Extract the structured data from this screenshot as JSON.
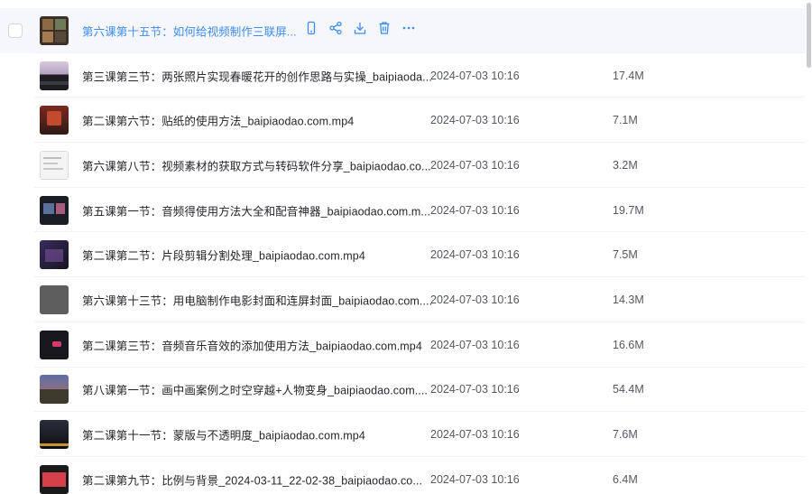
{
  "colors": {
    "accent": "#3f8cf0",
    "hover_bg": "#f5f7fd"
  },
  "hover_actions": [
    "phone-icon",
    "share-icon",
    "download-icon",
    "delete-icon",
    "more-icon"
  ],
  "files": [
    {
      "name": "第六课第十五节：如何给视频制作三联屏...",
      "date": "",
      "size": "",
      "thumb_icon": "video-thumbnail-icon",
      "hover": true,
      "thumb": "grid"
    },
    {
      "name": "第三课第三节：两张照片实现春暖花开的创作思路与实操_baipiaoda...",
      "date": "2024-07-03 10:16",
      "size": "17.4M",
      "thumb_icon": "video-thumbnail-icon",
      "thumb": "flower"
    },
    {
      "name": "第二课第六节：贴纸的使用方法_baipiaodao.com.mp4",
      "date": "2024-07-03 10:16",
      "size": "7.1M",
      "thumb_icon": "video-thumbnail-icon",
      "thumb": "red"
    },
    {
      "name": "第六课第八节：视频素材的获取方式与转码软件分享_baipiaodao.co...",
      "date": "2024-07-03 10:16",
      "size": "3.2M",
      "thumb_icon": "video-thumbnail-icon",
      "thumb": "doc"
    },
    {
      "name": "第五课第一节：音频得使用方法大全和配音神器_baipiaodao.com.m...",
      "date": "2024-07-03 10:16",
      "size": "19.7M",
      "thumb_icon": "video-thumbnail-icon",
      "thumb": "dark"
    },
    {
      "name": "第二课第二节：片段剪辑分割处理_baipiaodao.com.mp4",
      "date": "2024-07-03 10:16",
      "size": "7.5M",
      "thumb_icon": "video-thumbnail-icon",
      "thumb": "purple"
    },
    {
      "name": "第六课第十三节：用电脑制作电影封面和连屏封面_baipiaodao.com....",
      "date": "2024-07-03 10:16",
      "size": "14.3M",
      "thumb_icon": "video-thumbnail-icon",
      "thumb": "gray"
    },
    {
      "name": "第二课第三节：音频音乐音效的添加使用方法_baipiaodao.com.mp4",
      "date": "2024-07-03 10:16",
      "size": "16.6M",
      "thumb_icon": "video-thumbnail-icon",
      "thumb": "dark2"
    },
    {
      "name": "第八课第一节：画中画案例之时空穿越+人物变身_baipiaodao.com....",
      "date": "2024-07-03 10:16",
      "size": "54.4M",
      "thumb_icon": "video-thumbnail-icon",
      "thumb": "scene"
    },
    {
      "name": "第二课第十一节：蒙版与不透明度_baipiaodao.com.mp4",
      "date": "2024-07-03 10:16",
      "size": "7.6M",
      "thumb_icon": "video-thumbnail-icon",
      "thumb": "night"
    },
    {
      "name": "第二课第九节：比例与背景_2024-03-11_22-02-38_baipiaodao.co...",
      "date": "2024-07-03 10:16",
      "size": "6.4M",
      "thumb_icon": "video-thumbnail-icon",
      "thumb": "redbar"
    }
  ]
}
